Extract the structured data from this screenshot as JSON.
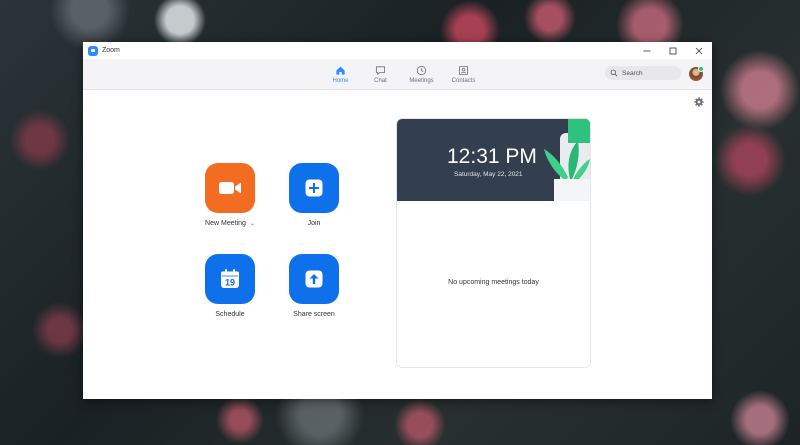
{
  "window": {
    "title": "Zoom"
  },
  "nav": {
    "tabs": [
      {
        "label": "Home",
        "icon": "home-icon",
        "active": true
      },
      {
        "label": "Chat",
        "icon": "chat-bubble-icon",
        "active": false
      },
      {
        "label": "Meetings",
        "icon": "clock-icon",
        "active": false
      },
      {
        "label": "Contacts",
        "icon": "contact-card-icon",
        "active": false
      }
    ],
    "search": {
      "placeholder": "Search",
      "value": ""
    }
  },
  "actions": {
    "new_meeting": "New Meeting",
    "join": "Join",
    "schedule": "Schedule",
    "schedule_day": "19",
    "share_screen": "Share screen"
  },
  "card": {
    "time": "12:31 PM",
    "date": "Saturday, May 22, 2021",
    "empty_message": "No upcoming meetings today"
  },
  "colors": {
    "accent": "#2d8cff",
    "action_blue": "#0e71eb",
    "new_meeting_orange": "#f26d21",
    "card_header": "#333f4f",
    "status_online": "#2fc567"
  }
}
